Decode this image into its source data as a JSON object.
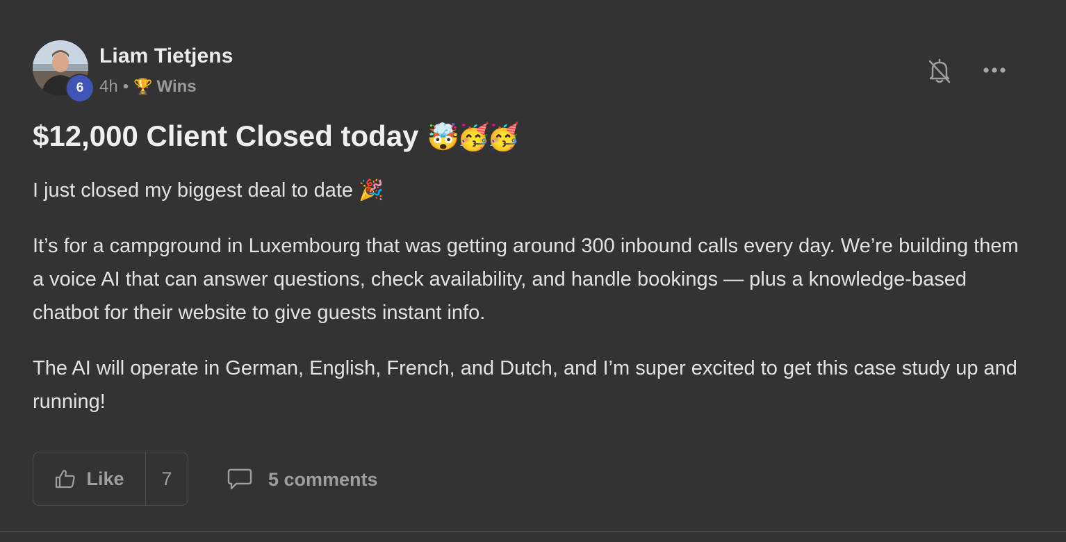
{
  "post": {
    "author": {
      "name": "Liam Tietjens",
      "level": "6",
      "time": "4h",
      "separator": "•",
      "category_icon": "🏆",
      "category": "Wins"
    },
    "title": "$12,000 Client Closed today",
    "title_emojis": "🤯🥳🥳",
    "paragraphs": [
      "I just closed my biggest deal to date 🎉",
      "It’s for a campground in Luxembourg that was getting around 300 inbound calls every day. We’re building them a voice AI that can answer questions, check availability, and handle bookings — plus a knowledge-based chatbot for their website to give guests instant info.",
      "The AI will operate in German, English, French, and Dutch, and I’m super excited to get this case study up and running!"
    ],
    "actions": {
      "like_label": "Like",
      "like_count": "7",
      "comments_label": "5 comments"
    },
    "icons": {
      "bell": "bell-off-icon",
      "more": "more-horizontal-icon",
      "like": "thumbs-up-icon",
      "comments": "comment-bubble-icon"
    },
    "colors": {
      "background": "#333333",
      "level_badge": "#3f55b5",
      "muted_text": "#9a9a9a"
    }
  }
}
